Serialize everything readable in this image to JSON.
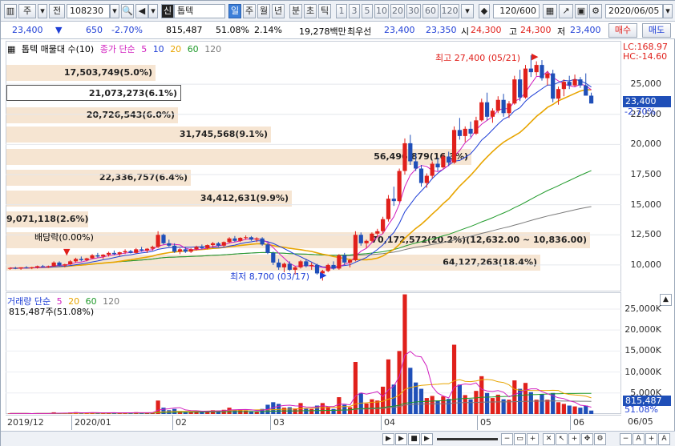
{
  "toolbar": {
    "market": "주",
    "prev_label": "전",
    "code": "108230",
    "stock_badge": "신",
    "stock_name": "톱텍",
    "periods": [
      "일",
      "주",
      "월",
      "년",
      "분",
      "초",
      "틱"
    ],
    "period_selected": "일",
    "intervals": [
      "1",
      "3",
      "5",
      "10",
      "20",
      "30",
      "60",
      "120"
    ],
    "count": "120/600",
    "date": "2020/06/05"
  },
  "quote": {
    "price": "23,400",
    "change": "650",
    "change_pct": "-2.70%",
    "volume": "815,487",
    "vol_ratio": "51.08%",
    "turnover": "2.14%",
    "amount": "19,278백만",
    "best_bid_label": "최우선",
    "best_ask": "23,400",
    "best_bid": "23,350",
    "open_label": "시",
    "open": "24,300",
    "high_label": "고",
    "high": "24,300",
    "low_label": "저",
    "low": "23,400",
    "buy_label": "매수",
    "sell_label": "매도"
  },
  "legend": {
    "stock": "톱텍 매물대 수(10)",
    "ma_label": "종가 단순",
    "ma_periods": [
      "5",
      "10",
      "20",
      "60",
      "120"
    ]
  },
  "right_panel": {
    "lc": "LC:168.97",
    "hc": "HC:-14.60",
    "current_price": "23,400",
    "current_pct": "-2.70%",
    "volume_value": "815,487",
    "volume_pct": "51.08%"
  },
  "volume_profile": [
    "17,503,749(5.0%)",
    "21,073,273(6.1%)",
    "20,726,543(6.0%)",
    "31,745,568(9.1%)",
    "56,496,879(16.3%)",
    "22,336,757(6.4%)",
    "34,412,631(9.9%)",
    "9,071,118(2.6%)",
    "70,172,572(20.2%)(12,632.00 ~ 10,836.00)",
    "64,127,263(18.4%)"
  ],
  "annotations": {
    "high": "최고 27,400 (05/21)",
    "low": "최저 8,700 (03/17)",
    "dividend": "배당락(0.00%)"
  },
  "volume_panel": {
    "label": "거래량 단순",
    "ma_periods": [
      "5",
      "20",
      "60",
      "120"
    ],
    "current": "815,487주(51.08%)"
  },
  "colors": {
    "up": "#e0201b",
    "down": "#1f4fb8",
    "ma5": "#d11fbf",
    "ma10": "#1f3fd6",
    "ma20": "#e8a500",
    "ma60": "#1f9a2a",
    "ma120": "#7a7a7a"
  },
  "chart_data": [
    {
      "type": "candlestick",
      "title": "톱텍 매물대 수(10)",
      "y_ticks": [
        "10,000",
        "12,500",
        "15,000",
        "17,500",
        "20,000",
        "22,500",
        "25,000"
      ],
      "ylim": [
        7800,
        28600
      ],
      "candles": [
        [
          9700,
          9800,
          9600,
          9750
        ],
        [
          9750,
          9850,
          9650,
          9700
        ],
        [
          9700,
          9800,
          9600,
          9800
        ],
        [
          9800,
          9900,
          9700,
          9750
        ],
        [
          9750,
          9850,
          9650,
          9800
        ],
        [
          9800,
          9950,
          9700,
          9900
        ],
        [
          9900,
          10000,
          9800,
          9850
        ],
        [
          9850,
          9950,
          9750,
          9900
        ],
        [
          9900,
          10300,
          9850,
          10200
        ],
        [
          10200,
          10300,
          9900,
          9950
        ],
        [
          9950,
          10100,
          9800,
          10050
        ],
        [
          10050,
          10400,
          10000,
          10300
        ],
        [
          10300,
          10600,
          10200,
          10500
        ],
        [
          10500,
          10700,
          10300,
          10400
        ],
        [
          10400,
          10600,
          10300,
          10550
        ],
        [
          10550,
          10900,
          10500,
          10800
        ],
        [
          10800,
          11000,
          10600,
          10700
        ],
        [
          10700,
          10900,
          10500,
          10850
        ],
        [
          10850,
          11100,
          10700,
          11000
        ],
        [
          11000,
          11200,
          10800,
          10900
        ],
        [
          10900,
          11100,
          10750,
          11050
        ],
        [
          11050,
          11300,
          10900,
          11150
        ],
        [
          11150,
          11250,
          10950,
          11000
        ],
        [
          11000,
          11400,
          10950,
          11300
        ],
        [
          11300,
          11500,
          11100,
          11200
        ],
        [
          11200,
          11400,
          11000,
          11350
        ],
        [
          11350,
          11600,
          11200,
          11500
        ],
        [
          11500,
          12800,
          11400,
          12500
        ],
        [
          12500,
          12600,
          11700,
          11800
        ],
        [
          11800,
          12100,
          11500,
          11600
        ],
        [
          11600,
          11800,
          11000,
          11100
        ],
        [
          11100,
          11400,
          10900,
          11300
        ],
        [
          11300,
          11500,
          11000,
          11100
        ],
        [
          11100,
          11400,
          11000,
          11300
        ],
        [
          11300,
          11600,
          11200,
          11500
        ],
        [
          11500,
          11700,
          11300,
          11400
        ],
        [
          11400,
          11700,
          11300,
          11650
        ],
        [
          11650,
          11900,
          11500,
          11800
        ],
        [
          11800,
          11900,
          11500,
          11600
        ],
        [
          11600,
          11950,
          11500,
          11900
        ],
        [
          11900,
          12300,
          11800,
          12200
        ],
        [
          12200,
          12400,
          11900,
          12000
        ],
        [
          12000,
          12300,
          11900,
          12250
        ],
        [
          12250,
          12450,
          12100,
          12300
        ],
        [
          12300,
          12400,
          12000,
          12100
        ],
        [
          12100,
          12300,
          11900,
          12200
        ],
        [
          12200,
          12300,
          11600,
          11700
        ],
        [
          11700,
          11800,
          10900,
          11000
        ],
        [
          11000,
          11100,
          10000,
          10200
        ],
        [
          10200,
          10500,
          9600,
          9800
        ],
        [
          9800,
          10200,
          9400,
          10100
        ],
        [
          10100,
          10300,
          9500,
          9600
        ],
        [
          9600,
          9900,
          9200,
          9800
        ],
        [
          9800,
          10400,
          9700,
          10300
        ],
        [
          10300,
          10500,
          9800,
          9900
        ],
        [
          9900,
          10200,
          9600,
          10000
        ],
        [
          10000,
          10100,
          9200,
          9300
        ],
        [
          9300,
          9600,
          8700,
          9500
        ],
        [
          9500,
          10100,
          9400,
          10000
        ],
        [
          10000,
          10300,
          9600,
          9700
        ],
        [
          9700,
          10900,
          9600,
          10800
        ],
        [
          10800,
          11000,
          10000,
          10200
        ],
        [
          10200,
          10500,
          9800,
          10400
        ],
        [
          10400,
          12800,
          10300,
          12500
        ],
        [
          12500,
          12700,
          11600,
          11800
        ],
        [
          11800,
          12100,
          11400,
          12000
        ],
        [
          12000,
          12700,
          11900,
          12600
        ],
        [
          12600,
          13000,
          12300,
          12800
        ],
        [
          12800,
          14000,
          12600,
          13800
        ],
        [
          13800,
          15800,
          13600,
          15500
        ],
        [
          15500,
          16500,
          14900,
          15300
        ],
        [
          15300,
          18000,
          15200,
          17800
        ],
        [
          17800,
          20500,
          17500,
          20100
        ],
        [
          20100,
          20800,
          18300,
          18600
        ],
        [
          18600,
          19300,
          17800,
          18000
        ],
        [
          18000,
          18300,
          16500,
          16800
        ],
        [
          16800,
          17600,
          16400,
          17400
        ],
        [
          17400,
          18600,
          17200,
          18400
        ],
        [
          18400,
          18900,
          17800,
          18100
        ],
        [
          18100,
          19200,
          18000,
          19000
        ],
        [
          19000,
          19400,
          18200,
          18500
        ],
        [
          18500,
          21500,
          18400,
          21200
        ],
        [
          21200,
          22200,
          20400,
          20700
        ],
        [
          20700,
          21500,
          20200,
          21300
        ],
        [
          21300,
          21900,
          20600,
          20900
        ],
        [
          20900,
          22300,
          20800,
          22000
        ],
        [
          22000,
          23800,
          21900,
          23500
        ],
        [
          23500,
          24300,
          22000,
          22300
        ],
        [
          22300,
          23000,
          21800,
          22800
        ],
        [
          22800,
          24000,
          22600,
          23700
        ],
        [
          23700,
          24200,
          22300,
          22600
        ],
        [
          22600,
          23600,
          22200,
          23400
        ],
        [
          23400,
          25700,
          23300,
          25400
        ],
        [
          25400,
          26200,
          23600,
          23900
        ],
        [
          23900,
          26600,
          23800,
          26300
        ],
        [
          26300,
          27400,
          25600,
          26000
        ],
        [
          26000,
          26900,
          25700,
          26600
        ],
        [
          26600,
          27000,
          25300,
          25500
        ],
        [
          25500,
          26100,
          24900,
          25900
        ],
        [
          25900,
          26200,
          23500,
          23800
        ],
        [
          23800,
          24800,
          23300,
          24600
        ],
        [
          24600,
          25400,
          24000,
          25200
        ],
        [
          25200,
          25700,
          24600,
          24900
        ],
        [
          24900,
          25800,
          24800,
          25400
        ],
        [
          25400,
          25600,
          24700,
          24900
        ],
        [
          24900,
          25900,
          24300,
          24050
        ],
        [
          24050,
          24300,
          23400,
          23400
        ]
      ]
    },
    {
      "type": "bar",
      "title": "거래량",
      "y_ticks": [
        "5,000K",
        "10,000K",
        "15,000K",
        "20,000K",
        "25,000K"
      ],
      "ylim": [
        0,
        29000
      ],
      "values": [
        120,
        110,
        90,
        100,
        95,
        130,
        110,
        100,
        400,
        250,
        180,
        350,
        420,
        260,
        200,
        380,
        300,
        240,
        350,
        260,
        220,
        330,
        250,
        420,
        300,
        260,
        380,
        3200,
        1500,
        900,
        1200,
        700,
        600,
        650,
        800,
        600,
        700,
        900,
        700,
        1000,
        1500,
        900,
        1100,
        800,
        700,
        650,
        1200,
        2200,
        2800,
        2400,
        1500,
        1600,
        1300,
        2600,
        1400,
        1200,
        2000,
        2600,
        1800,
        1200,
        4000,
        2200,
        1600,
        12400,
        5000,
        2500,
        3500,
        3200,
        6500,
        13000,
        7000,
        15000,
        28500,
        11000,
        7500,
        6000,
        3800,
        4300,
        3200,
        4200,
        3600,
        16500,
        7000,
        4500,
        3500,
        5500,
        9000,
        5000,
        3800,
        4600,
        3500,
        3400,
        8000,
        6000,
        7400,
        5200,
        3400,
        4700,
        3400,
        5000,
        2800,
        2400,
        2000,
        1800,
        1500,
        2000,
        815
      ]
    }
  ],
  "dates": [
    "2019/12",
    "2020/01",
    "02",
    "03",
    "04",
    "05",
    "06",
    "06/05"
  ]
}
